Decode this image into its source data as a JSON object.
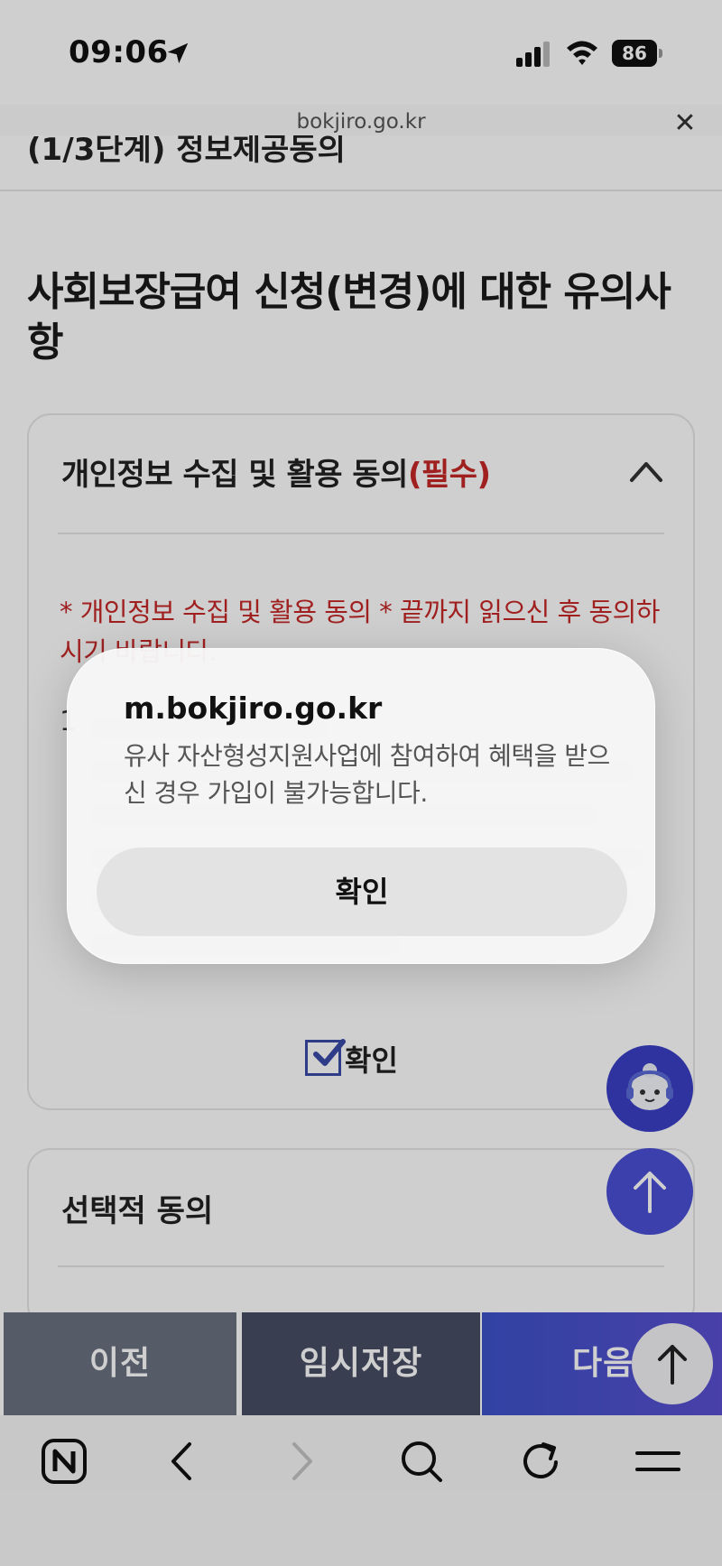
{
  "status_bar": {
    "time": "09:06",
    "battery": "86"
  },
  "url_bar": {
    "domain": "bokjiro.go.kr"
  },
  "page": {
    "step_header": "(1/3단계) 정보제공동의",
    "title": "사회보장급여 신청(변경)에 대한 유의사항"
  },
  "consent_card": {
    "title": "개인정보 수집 및 활용 동의",
    "required_tag": "(필수)",
    "notice": "* 개인정보 수집 및 활용 동의 * 끝까지 읽으신 후 동의하시기 바랍니다.",
    "term_number": "1",
    "confirm_label": "확인"
  },
  "optional_card": {
    "title": "선택적 동의"
  },
  "action_bar": {
    "prev": "이전",
    "save_draft": "임시저장",
    "next": "다음"
  },
  "alert": {
    "title": "m.bokjiro.go.kr",
    "message": "유사 자산형성지원사업에 참여하여 혜택을 받으신 경우 가입이 불가능합니다.",
    "ok_label": "확인"
  }
}
